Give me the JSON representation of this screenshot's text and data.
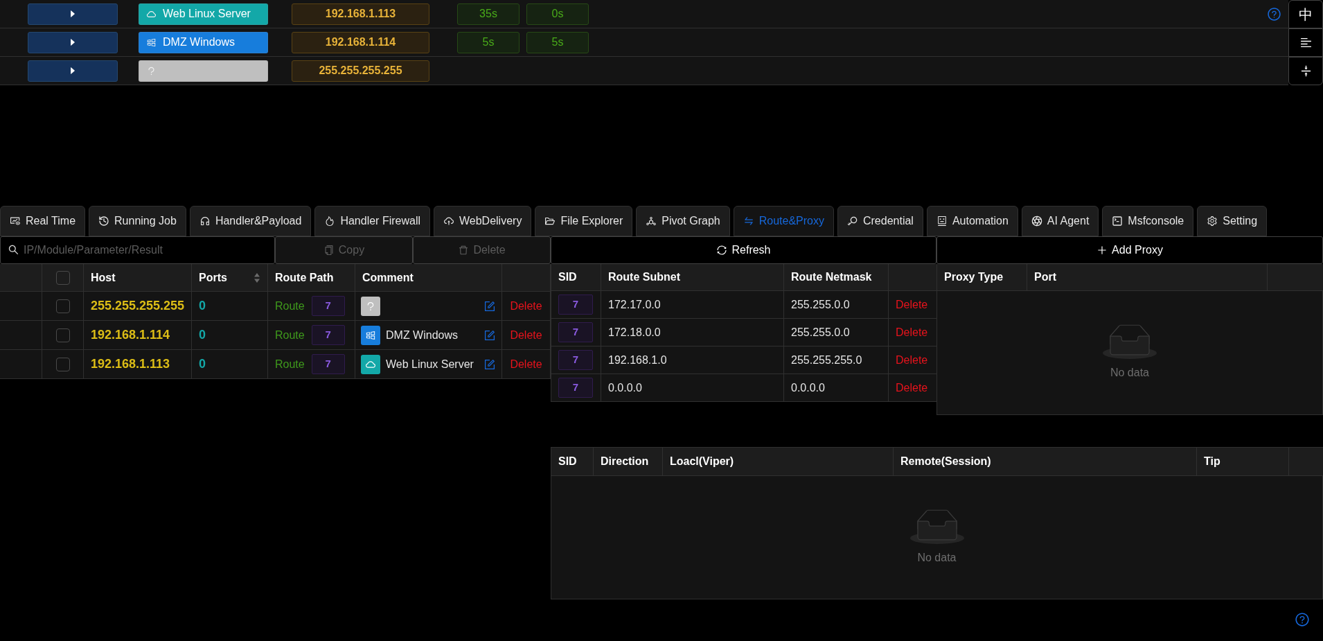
{
  "sessions": [
    {
      "kind": "linux",
      "comment": "Web Linux Server",
      "ip": "192.168.1.113",
      "times": [
        "35s",
        "0s"
      ]
    },
    {
      "kind": "windows",
      "comment": "DMZ Windows",
      "ip": "192.168.1.114",
      "times": [
        "5s",
        "5s"
      ]
    },
    {
      "kind": "unknown",
      "ip": "255.255.255.255"
    }
  ],
  "side_buttons": [
    {
      "kind": "text",
      "label": "中"
    },
    {
      "kind": "align"
    },
    {
      "kind": "compress"
    }
  ],
  "tabs": [
    {
      "label": "Real Time",
      "selected": false
    },
    {
      "label": "Running Job",
      "selected": false
    },
    {
      "label": "Handler&Payload",
      "selected": false
    },
    {
      "label": "Handler Firewall",
      "selected": false
    },
    {
      "label": "WebDelivery",
      "selected": false
    },
    {
      "label": "File Explorer",
      "selected": false
    },
    {
      "label": "Pivot Graph",
      "selected": false
    },
    {
      "label": "Route&Proxy",
      "selected": true
    },
    {
      "label": "Credential",
      "selected": false
    },
    {
      "label": "Automation",
      "selected": false
    },
    {
      "label": "AI Agent",
      "selected": false
    },
    {
      "label": "Msfconsole",
      "selected": false
    },
    {
      "label": "Setting",
      "selected": false
    }
  ],
  "hosts": {
    "search": {
      "placeholder": "IP/Module/Parameter/Result"
    },
    "buttons": [
      {
        "label": "Copy",
        "disabled": true
      },
      {
        "label": "Delete",
        "disabled": true
      }
    ],
    "all_checked": false,
    "columns": [
      {
        "label": "Host",
        "sortable": false
      },
      {
        "label": "Ports",
        "sortable": true
      },
      {
        "label": "Route Path",
        "sortable": false
      },
      {
        "label": "Comment",
        "sortable": false
      }
    ],
    "rows": [
      {
        "checked": false,
        "host": "255.255.255.255",
        "ports": "0",
        "route": "Route",
        "sid": "7",
        "kind": "unknown",
        "action": "Delete"
      },
      {
        "checked": false,
        "host": "192.168.1.114",
        "ports": "0",
        "route": "Route",
        "sid": "7",
        "kind": "windows",
        "comment": "DMZ Windows",
        "action": "Delete"
      },
      {
        "checked": false,
        "host": "192.168.1.113",
        "ports": "0",
        "route": "Route",
        "sid": "7",
        "kind": "linux",
        "comment": "Web Linux Server",
        "action": "Delete"
      }
    ]
  },
  "routes": {
    "button": "Refresh",
    "columns": [
      "SID",
      "Route Subnet",
      "Route Netmask"
    ],
    "rows": [
      {
        "sid": "7",
        "subnet": "172.17.0.0",
        "netmask": "255.255.0.0",
        "action": "Delete"
      },
      {
        "sid": "7",
        "subnet": "172.18.0.0",
        "netmask": "255.255.0.0",
        "action": "Delete"
      },
      {
        "sid": "7",
        "subnet": "192.168.1.0",
        "netmask": "255.255.255.0",
        "action": "Delete"
      },
      {
        "sid": "7",
        "subnet": "0.0.0.0",
        "netmask": "0.0.0.0",
        "action": "Delete"
      }
    ]
  },
  "proxies": {
    "button": "Add Proxy",
    "columns": [
      "Proxy Type",
      "Port"
    ],
    "empty": "No data"
  },
  "forwards": {
    "columns": [
      "SID",
      "Direction",
      "Loacl(Viper)",
      "Remote(Session)",
      "Tip"
    ],
    "empty": "No data"
  }
}
